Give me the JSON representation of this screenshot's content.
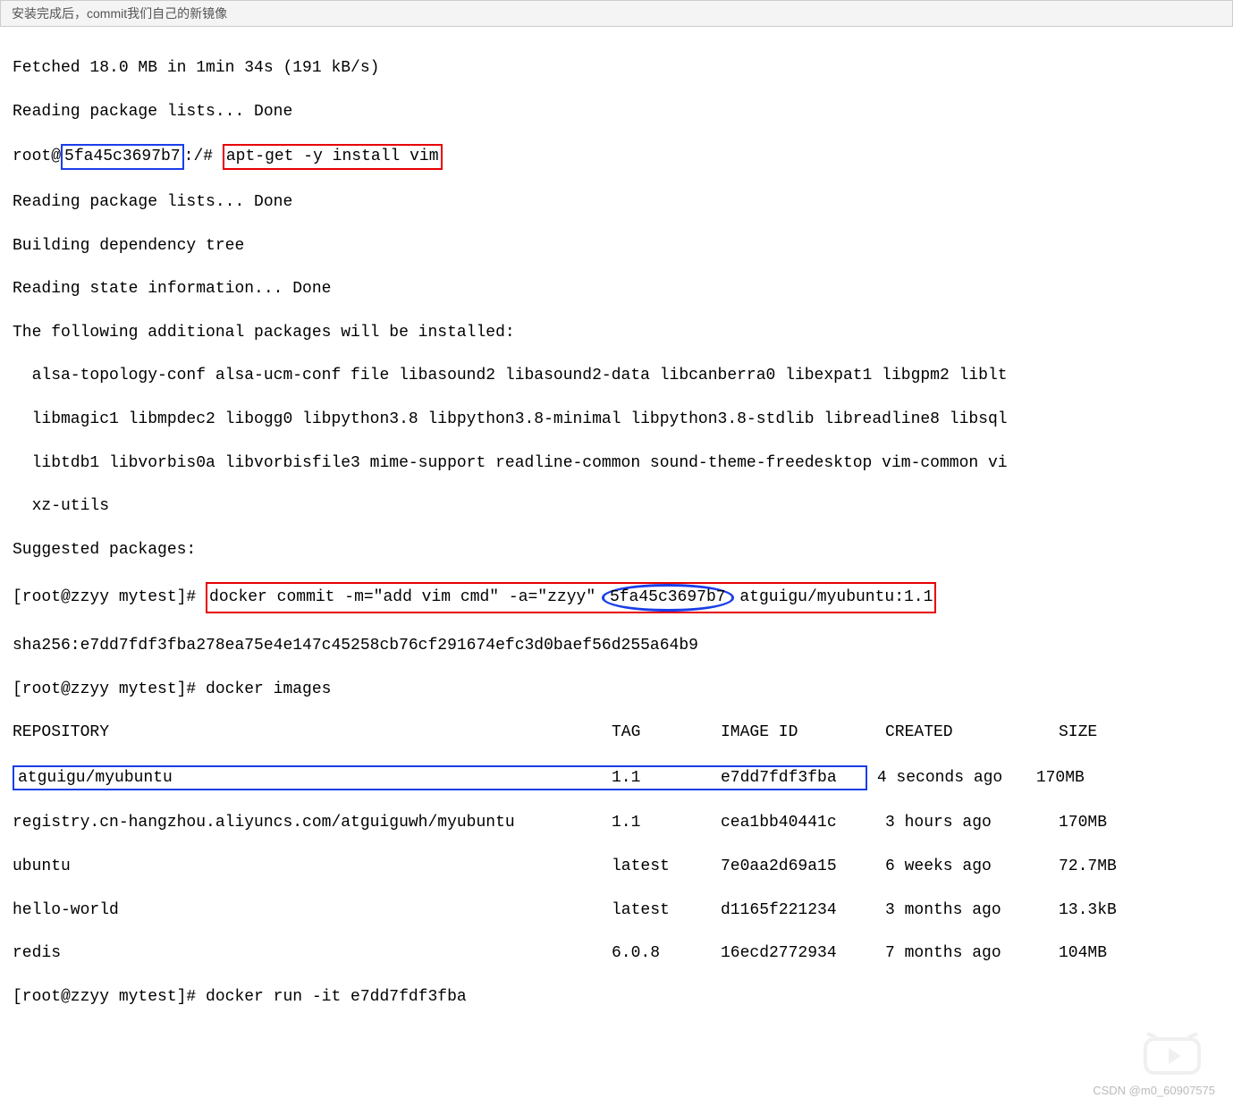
{
  "tab": {
    "label": "安装完成后，commit我们自己的新镜像"
  },
  "term": {
    "l1": "Fetched 18.0 MB in 1min 34s (191 kB/s)",
    "l2": "Reading package lists... Done",
    "l3a": "root@",
    "l3b": "5fa45c3697b7",
    "l3c": ":/# ",
    "l3d": "apt-get -y install vim",
    "l4": "Reading package lists... Done",
    "l5": "Building dependency tree",
    "l6": "Reading state information... Done",
    "l7": "The following additional packages will be installed:",
    "l8": "  alsa-topology-conf alsa-ucm-conf file libasound2 libasound2-data libcanberra0 libexpat1 libgpm2 liblt",
    "l9": "  libmagic1 libmpdec2 libogg0 libpython3.8 libpython3.8-minimal libpython3.8-stdlib libreadline8 libsql",
    "l10": "  libtdb1 libvorbis0a libvorbisfile3 mime-support readline-common sound-theme-freedesktop vim-common vi",
    "l11": "  xz-utils",
    "l12": "Suggested packages:",
    "l13a": "[root@zzyy mytest]# ",
    "l13b": "docker commit -m=\"add vim cmd\" -a=\"zzyy\"",
    "l13c": "5fa45c3697b7",
    "l13d": "atguigu/myubuntu:1.1",
    "l14": "sha256:e7dd7fdf3fba278ea75e4e147c45258cb76cf291674efc3d0baef56d255a64b9",
    "l15": "[root@zzyy mytest]# docker images",
    "hdr": {
      "repo": "REPOSITORY",
      "tag": "TAG",
      "img": "IMAGE ID",
      "cre": "CREATED",
      "size": "SIZE"
    },
    "rows": [
      {
        "repo": "atguigu/myubuntu",
        "tag": "1.1",
        "img": "e7dd7fdf3fba",
        "cre": "4 seconds ago",
        "size": "170MB"
      },
      {
        "repo": "registry.cn-hangzhou.aliyuncs.com/atguiguwh/myubuntu",
        "tag": "1.1",
        "img": "cea1bb40441c",
        "cre": "3 hours ago",
        "size": "170MB"
      },
      {
        "repo": "ubuntu",
        "tag": "latest",
        "img": "7e0aa2d69a15",
        "cre": "6 weeks ago",
        "size": "72.7MB"
      },
      {
        "repo": "hello-world",
        "tag": "latest",
        "img": "d1165f221234",
        "cre": "3 months ago",
        "size": "13.3kB"
      },
      {
        "repo": "redis",
        "tag": "6.0.8",
        "img": "16ecd2772934",
        "cre": "7 months ago",
        "size": "104MB"
      }
    ],
    "l_last": "[root@zzyy mytest]# docker run -it e7dd7fdf3fba"
  },
  "watermark": "CSDN @m0_60907575"
}
